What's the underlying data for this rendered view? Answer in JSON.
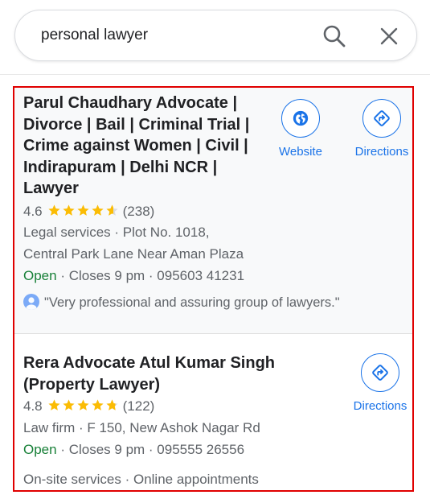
{
  "search": {
    "query": "personal lawyer"
  },
  "colors": {
    "accent": "#1a73e8",
    "open": "#188038",
    "star": "#fbbc04",
    "highlight": "#e00000"
  },
  "results": [
    {
      "title_lines": [
        "Parul Chaudhary Advocate |",
        "Divorce | Bail | Criminal Trial |",
        "Crime against Women | Civil |",
        "Indirapuram | Delhi NCR |",
        "Lawyer"
      ],
      "rating": "4.6",
      "stars": 4.6,
      "reviews": "(238)",
      "category_address_1": "Legal services · Plot No. 1018,",
      "category_address_2": "Central Park Lane Near Aman Plaza",
      "status": "Open",
      "hours_phone": "· Closes 9 pm · 095603 41231",
      "review_quote": "\"Very professional and assuring group of lawyers.\"",
      "actions": {
        "website": "Website",
        "directions": "Directions"
      }
    },
    {
      "title_lines": [
        "Rera Advocate Atul Kumar Singh",
        "(Property Lawyer)"
      ],
      "rating": "4.8",
      "stars": 4.8,
      "reviews": "(122)",
      "category_address_1": "Law firm · F 150, New Ashok Nagar Rd",
      "status": "Open",
      "hours_phone": "· Closes 9 pm · 095555 26556",
      "services": "On-site services · Online appointments",
      "actions": {
        "directions": "Directions"
      }
    }
  ]
}
